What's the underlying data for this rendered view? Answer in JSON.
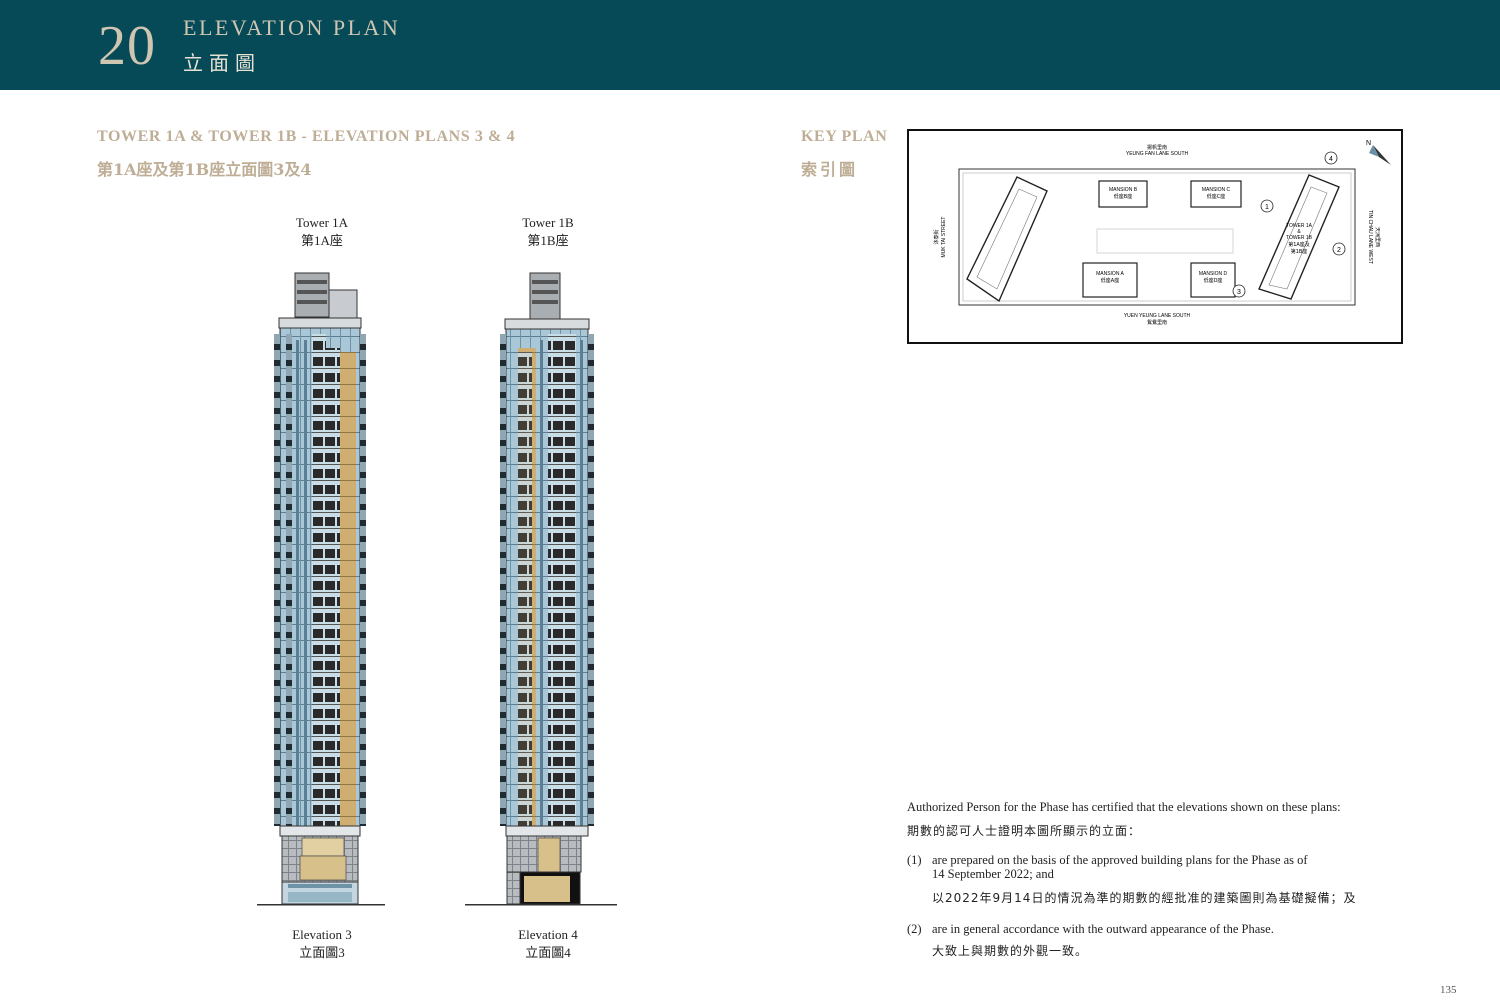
{
  "header": {
    "chapter_number": "20",
    "title_en": "ELEVATION PLAN",
    "title_zh": "立面圖"
  },
  "section": {
    "title_en": "TOWER 1A & TOWER 1B - ELEVATION PLANS 3 & 4",
    "title_zh": "第1A座及第1B座立面圖3及4"
  },
  "towers": [
    {
      "name_en": "Tower 1A",
      "name_zh": "第1A座",
      "elevation_en": "Elevation 3",
      "elevation_zh": "立面圖3"
    },
    {
      "name_en": "Tower 1B",
      "name_zh": "第1B座",
      "elevation_en": "Elevation 4",
      "elevation_zh": "立面圖4"
    }
  ],
  "key_plan": {
    "title_en": "KEY PLAN",
    "title_zh": "索引圖",
    "streets": {
      "north_zh": "揚帆里南",
      "north_en": "YEUNG FAN LANE SOUTH",
      "south_en": "YUEN YEUNG LANE SOUTH",
      "south_zh": "鴛鴦里南",
      "west_en": "MUK TAI STREET",
      "west_zh": "沐泰街",
      "east_en": "TIN CHAU LANE WEST",
      "east_zh": "天洲里西"
    },
    "buildings": [
      {
        "en": "MANSION B",
        "zh": "低座B座"
      },
      {
        "en": "MANSION C",
        "zh": "低座C座"
      },
      {
        "en": "MANSION A",
        "zh": "低座A座"
      },
      {
        "en": "MANSION D",
        "zh": "低座D座"
      },
      {
        "en_1": "TOWER 1A",
        "amp": "&",
        "en_2": "TOWER 1B",
        "zh_1": "第1A座及",
        "zh_2": "第1B座"
      }
    ],
    "markers": [
      "1",
      "2",
      "3",
      "4"
    ],
    "north_label": "N"
  },
  "notes": {
    "intro_en": "Authorized Person for the Phase has certified that the elevations shown on these plans:",
    "intro_zh": "期數的認可人士證明本圖所顯示的立面：",
    "items": [
      {
        "num": "(1)",
        "en_1": "are prepared on the basis of the approved building plans for the Phase as of",
        "en_2": "14 September 2022; and",
        "zh": "以2022年9月14日的情況為準的期數的經批准的建築圖則為基礎擬備；及"
      },
      {
        "num": "(2)",
        "en_1": "are in general accordance with the outward appearance of the Phase.",
        "zh": "大致上與期數的外觀一致。"
      }
    ]
  },
  "page_number": "135",
  "colors": {
    "header_bg": "#064a58",
    "accent_gold": "#bfae96",
    "glass_blue": "#a9c7d7",
    "facade_gold": "#cfae72"
  }
}
